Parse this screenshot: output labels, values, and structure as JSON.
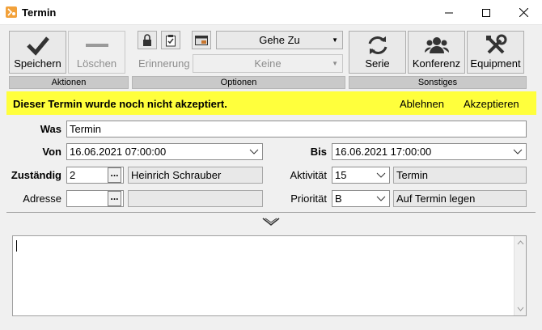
{
  "window": {
    "title": "Termin"
  },
  "ribbon": {
    "save_label": "Speichern",
    "delete_label": "Löschen",
    "group_actions": "Aktionen",
    "reminder_label": "Erinnerung",
    "reminder_value": "Keine",
    "goto_label": "Gehe Zu",
    "group_options": "Optionen",
    "series_label": "Serie",
    "conference_label": "Konferenz",
    "equipment_label": "Equipment",
    "group_misc": "Sonstiges"
  },
  "infobar": {
    "text": "Dieser Termin wurde noch nicht akzeptiert.",
    "decline_label": "Ablehnen",
    "accept_label": "Akzeptieren"
  },
  "form": {
    "was_label": "Was",
    "was_value": "Termin",
    "von_label": "Von",
    "von_value": "16.06.2021 07:00:00",
    "bis_label": "Bis",
    "bis_value": "16.06.2021 17:00:00",
    "zustaendig_label": "Zuständig",
    "zustaendig_id": "2",
    "zustaendig_name": "Heinrich Schrauber",
    "aktivitaet_label": "Aktivität",
    "aktivitaet_code": "15",
    "aktivitaet_name": "Termin",
    "adresse_label": "Adresse",
    "adresse_id": "",
    "adresse_name": "",
    "prioritaet_label": "Priorität",
    "prioritaet_code": "B",
    "prioritaet_name": "Auf Termin legen",
    "dots": "..."
  },
  "notes": {
    "value": ""
  },
  "colors": {
    "info_bg": "#ffff3c",
    "ribbon_group": "#c9c9c9"
  }
}
